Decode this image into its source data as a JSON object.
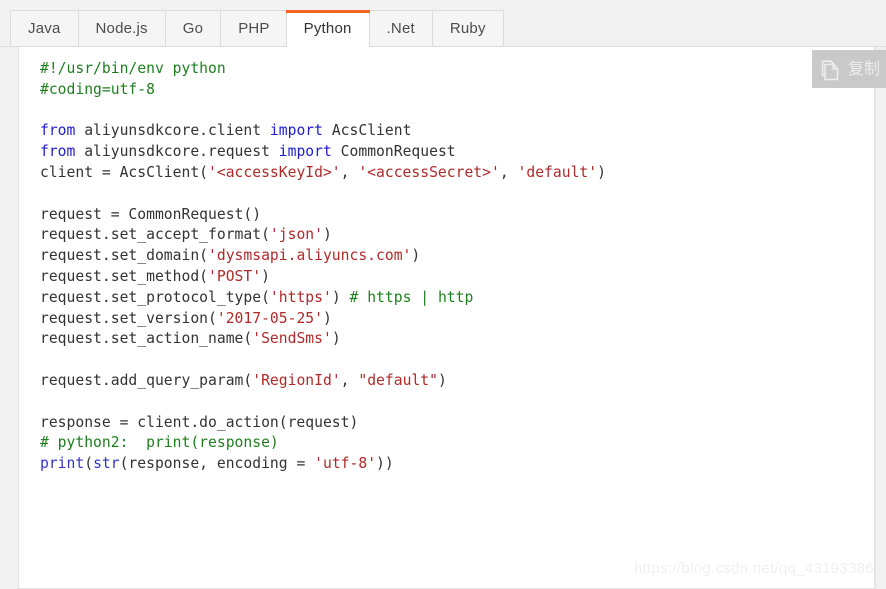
{
  "tabs": [
    {
      "label": "Java",
      "active": false
    },
    {
      "label": "Node.js",
      "active": false
    },
    {
      "label": "Go",
      "active": false
    },
    {
      "label": "PHP",
      "active": false
    },
    {
      "label": "Python",
      "active": true
    },
    {
      "label": ".Net",
      "active": false
    },
    {
      "label": "Ruby",
      "active": false
    }
  ],
  "copy_button": {
    "label": "复制",
    "icon": "copy-document-icon"
  },
  "watermark": {
    "text": "https://blog.csdn.net/qq_43193386"
  },
  "colors": {
    "accent": "#f26522",
    "comment": "#1f7f1f",
    "keyword": "#2020d0",
    "string": "#b02a2a",
    "plain": "#333333",
    "panel_bg": "#ffffff",
    "page_bg": "#f1f1f1",
    "copy_bg": "#c9c9c9"
  },
  "code": {
    "language": "Python",
    "lines": [
      [
        {
          "t": "#!/usr/bin/env python",
          "c": "cm"
        }
      ],
      [
        {
          "t": "#coding=utf-8",
          "c": "cm"
        }
      ],
      [],
      [
        {
          "t": "from",
          "c": "kw"
        },
        {
          "t": " aliyunsdkcore.client ",
          "c": "pl"
        },
        {
          "t": "import",
          "c": "kw"
        },
        {
          "t": " AcsClient",
          "c": "pl"
        }
      ],
      [
        {
          "t": "from",
          "c": "kw"
        },
        {
          "t": " aliyunsdkcore.request ",
          "c": "pl"
        },
        {
          "t": "import",
          "c": "kw"
        },
        {
          "t": " CommonRequest",
          "c": "pl"
        }
      ],
      [
        {
          "t": "client = AcsClient(",
          "c": "pl"
        },
        {
          "t": "'<accessKeyId>'",
          "c": "st"
        },
        {
          "t": ", ",
          "c": "pl"
        },
        {
          "t": "'<accessSecret>'",
          "c": "st"
        },
        {
          "t": ", ",
          "c": "pl"
        },
        {
          "t": "'default'",
          "c": "st"
        },
        {
          "t": ")",
          "c": "pl"
        }
      ],
      [],
      [
        {
          "t": "request = CommonRequest()",
          "c": "pl"
        }
      ],
      [
        {
          "t": "request.set_accept_format(",
          "c": "pl"
        },
        {
          "t": "'json'",
          "c": "st"
        },
        {
          "t": ")",
          "c": "pl"
        }
      ],
      [
        {
          "t": "request.set_domain(",
          "c": "pl"
        },
        {
          "t": "'dysmsapi.aliyuncs.com'",
          "c": "st"
        },
        {
          "t": ")",
          "c": "pl"
        }
      ],
      [
        {
          "t": "request.set_method(",
          "c": "pl"
        },
        {
          "t": "'POST'",
          "c": "st"
        },
        {
          "t": ")",
          "c": "pl"
        }
      ],
      [
        {
          "t": "request.set_protocol_type(",
          "c": "pl"
        },
        {
          "t": "'https'",
          "c": "st"
        },
        {
          "t": ") ",
          "c": "pl"
        },
        {
          "t": "# https | http",
          "c": "cm"
        }
      ],
      [
        {
          "t": "request.set_version(",
          "c": "pl"
        },
        {
          "t": "'2017-05-25'",
          "c": "st"
        },
        {
          "t": ")",
          "c": "pl"
        }
      ],
      [
        {
          "t": "request.set_action_name(",
          "c": "pl"
        },
        {
          "t": "'SendSms'",
          "c": "st"
        },
        {
          "t": ")",
          "c": "pl"
        }
      ],
      [],
      [
        {
          "t": "request.add_query_param(",
          "c": "pl"
        },
        {
          "t": "'RegionId'",
          "c": "st"
        },
        {
          "t": ", ",
          "c": "pl"
        },
        {
          "t": "\"default\"",
          "c": "st"
        },
        {
          "t": ")",
          "c": "pl"
        }
      ],
      [],
      [
        {
          "t": "response = client.do_action(request)",
          "c": "pl"
        }
      ],
      [
        {
          "t": "# python2:  print(response)",
          "c": "cm"
        }
      ],
      [
        {
          "t": "print",
          "c": "bi"
        },
        {
          "t": "(",
          "c": "pl"
        },
        {
          "t": "str",
          "c": "bi"
        },
        {
          "t": "(response, encoding = ",
          "c": "pl"
        },
        {
          "t": "'utf-8'",
          "c": "st"
        },
        {
          "t": "))",
          "c": "pl"
        }
      ]
    ]
  }
}
